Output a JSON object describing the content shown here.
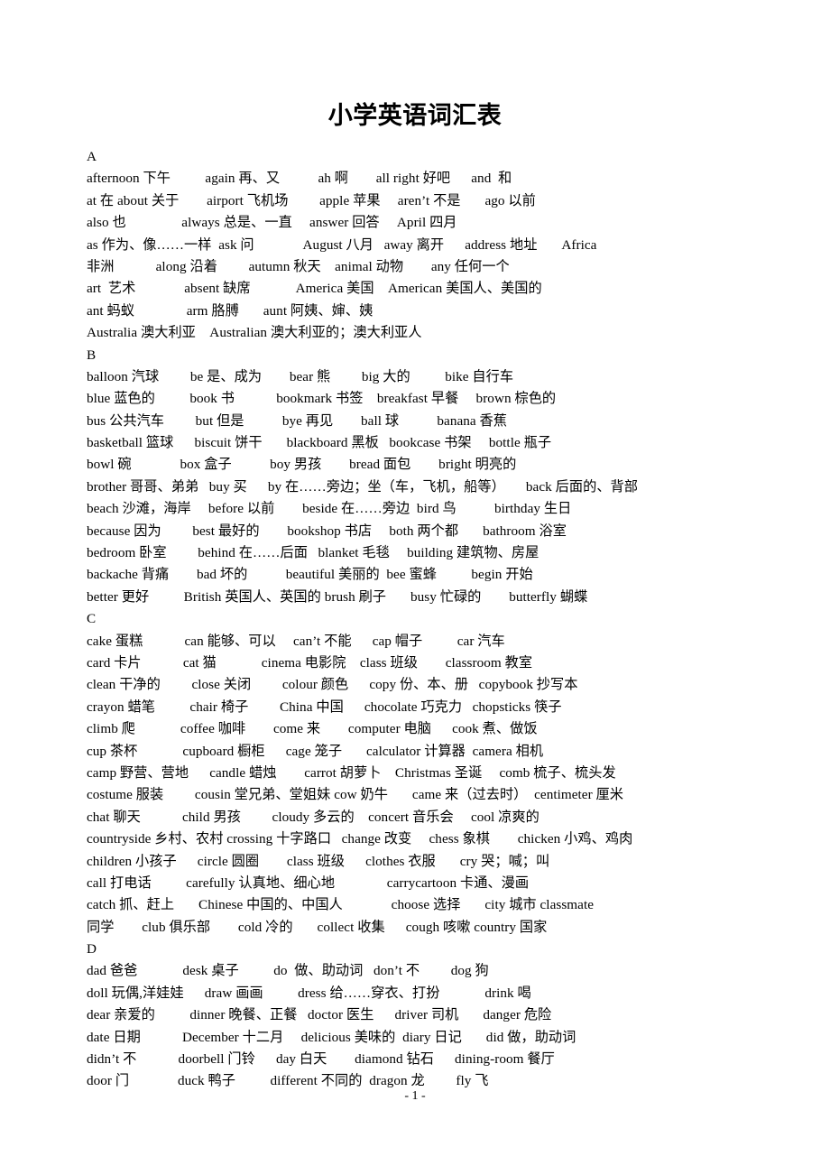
{
  "document": {
    "title": "小学英语词汇表",
    "footer": "- 1 -"
  },
  "sections": [
    {
      "letter": "A",
      "lines": [
        "afternoon 下午          again 再、又           ah 啊        all right 好吧      and  和",
        "at 在 about 关于        airport 飞机场         apple 苹果     aren’t 不是       ago 以前",
        "also 也                always 总是、一直     answer 回答     April 四月",
        "as 作为、像……一样  ask 问              August 八月   away 离开      address 地址       Africa",
        "非洲            along 沿着         autumn 秋天    animal 动物        any 任何一个",
        "art  艺术              absent 缺席             America 美国    American 美国人、美国的",
        "ant 蚂蚁               arm 胳膊       aunt 阿姨、婶、姨",
        "Australia 澳大利亚    Australian 澳大利亚的；澳大利亚人"
      ]
    },
    {
      "letter": "B",
      "lines": [
        "balloon 汽球         be 是、成为        bear 熊         big 大的          bike 自行车",
        "blue 蓝色的          book 书            bookmark 书签    breakfast 早餐     brown 棕色的",
        "bus 公共汽车         but 但是           bye 再见        ball 球           banana 香蕉",
        "basketball 篮球      biscuit 饼干       blackboard 黑板   bookcase 书架     bottle 瓶子",
        "bowl 碗              box 盒子           boy 男孩        bread 面包        bright 明亮的",
        "brother 哥哥、弟弟   buy 买      by 在……旁边；坐（车，飞机，船等）      back 后面的、背部",
        "beach 沙滩，海岸     before 以前        beside 在……旁边  bird 鸟           birthday 生日",
        "because 因为         best 最好的        bookshop 书店     both 两个都       bathroom 浴室",
        "bedroom 卧室         behind 在……后面   blanket 毛毯     building 建筑物、房屋",
        "backache 背痛        bad 坏的           beautiful 美丽的  bee 蜜蜂          begin 开始",
        "better 更好          British 英国人、英国的 brush 刷子       busy 忙碌的        butterfly 蝴蝶"
      ]
    },
    {
      "letter": "C",
      "lines": [
        "cake 蛋糕            can 能够、可以     can’t 不能      cap 帽子          car 汽车",
        "card 卡片            cat 猫             cinema 电影院    class 班级        classroom 教室",
        "clean 干净的         close 关闭         colour 颜色      copy 份、本、册   copybook 抄写本",
        "crayon 蜡笔          chair 椅子         China 中国      chocolate 巧克力   chopsticks 筷子",
        "climb 爬             coffee 咖啡        come 来        computer 电脑      cook 煮、做饭",
        "cup 茶杯             cupboard 橱柜      cage 笼子       calculator 计算器  camera 相机",
        "camp 野营、营地      candle 蜡烛        carrot 胡萝卜    Christmas 圣诞     comb 梳子、梳头发",
        "costume 服装         cousin 堂兄弟、堂姐妹 cow 奶牛       came 来（过去时）  centimeter 厘米",
        "chat 聊天            child 男孩         cloudy 多云的    concert 音乐会     cool 凉爽的",
        "countryside 乡村、农村 crossing 十字路口   change 改变     chess 象棋        chicken 小鸡、鸡肉",
        "children 小孩子      circle 圆圈        class 班级      clothes 衣服       cry 哭；喊；叫",
        "call 打电话          carefully 认真地、细心地               carrycartoon 卡通、漫画",
        "catch 抓、赶上       Chinese 中国的、中国人              choose 选择       city 城市 classmate",
        "同学        club 俱乐部        cold 冷的       collect 收集      cough 咳嗽 country 国家"
      ]
    },
    {
      "letter": "D",
      "lines": [
        "dad 爸爸             desk 桌子          do  做、助动词   don’t 不         dog 狗",
        "doll 玩偶,洋娃娃      draw 画画          dress 给……穿衣、打扮             drink 喝",
        "dear 亲爱的          dinner 晚餐、正餐   doctor 医生      driver 司机       danger 危险",
        "date 日期            December 十二月     delicious 美味的  diary 日记       did 做，助动词",
        "didn’t 不            doorbell 门铃      day 白天        diamond 钻石      dining-room 餐厅",
        "door 门              duck 鸭子          different 不同的  dragon 龙         fly 飞"
      ]
    }
  ]
}
